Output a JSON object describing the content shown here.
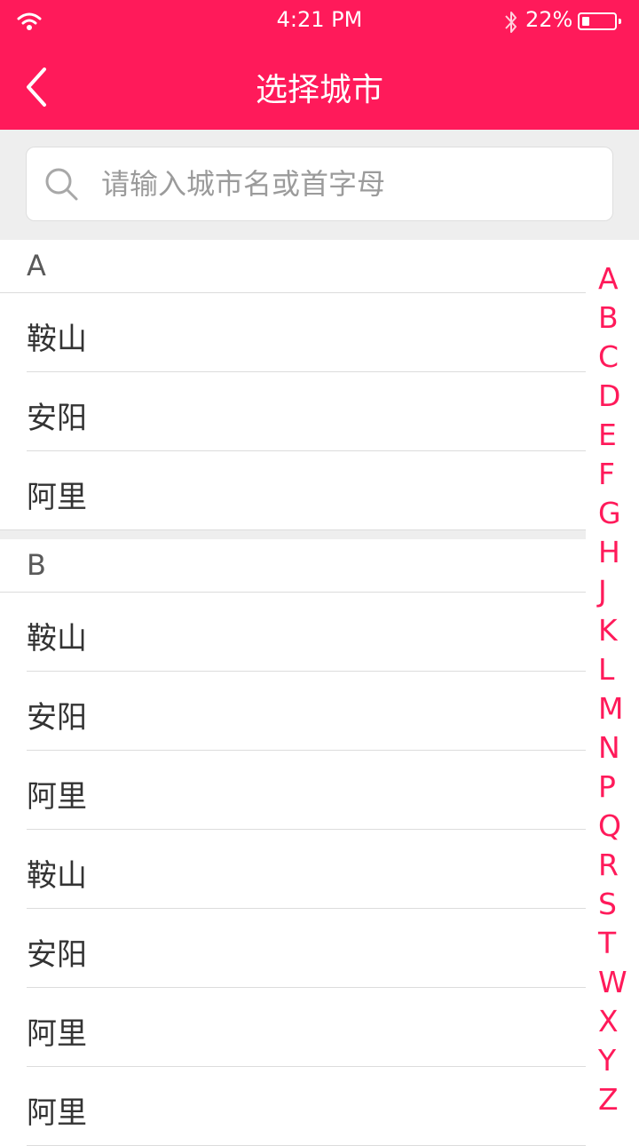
{
  "status": {
    "time": "4:21 PM",
    "battery": "22%",
    "battery_level": 0.22
  },
  "header": {
    "title": "选择城市"
  },
  "search": {
    "placeholder": "请输入城市名或首字母",
    "value": ""
  },
  "sections": [
    {
      "letter": "A",
      "cities": [
        "鞍山",
        "安阳",
        "阿里"
      ]
    },
    {
      "letter": "B",
      "cities": [
        "鞍山",
        "安阳",
        "阿里",
        "鞍山",
        "安阳",
        "阿里",
        "阿里"
      ]
    }
  ],
  "index_letters": [
    "A",
    "B",
    "C",
    "D",
    "E",
    "F",
    "G",
    "H",
    "J",
    "K",
    "L",
    "M",
    "N",
    "P",
    "Q",
    "R",
    "S",
    "T",
    "W",
    "X",
    "Y",
    "Z"
  ],
  "colors": {
    "accent": "#ff1a5a",
    "background_gray": "#eeeeee"
  }
}
